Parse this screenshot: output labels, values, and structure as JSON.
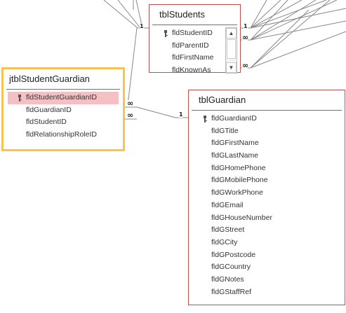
{
  "tables": {
    "students": {
      "title": "tblStudents",
      "fields": [
        "fldStudentID",
        "fldParentID",
        "fldFirstName",
        "fldKnownAs"
      ],
      "key_field_index": 0,
      "has_scrollbar": true
    },
    "student_guardian": {
      "title": "jtblStudentGuardian",
      "fields": [
        "fldStudentGuardianID",
        "fldGuardianID",
        "fldStudentID",
        "fldRelationshipRoleID"
      ],
      "key_field_index": 0,
      "selected": true
    },
    "guardian": {
      "title": "tblGuardian",
      "fields": [
        "fldGuardianID",
        "fldGTitle",
        "fldGFirstName",
        "fldGLastName",
        "fldGHomePhone",
        "fldGMobilePhone",
        "fldGWorkPhone",
        "fldGEmail",
        "fldGHouseNumber",
        "fldGStreet",
        "fldGCity",
        "fldGPostcode",
        "fldGCountry",
        "fldGNotes",
        "fldGStaffRef"
      ],
      "key_field_index": 0
    }
  },
  "cardinality_labels": {
    "one": "1",
    "many": "∞"
  },
  "icons": {
    "primary_key": "key-icon",
    "scroll_up": "chevron-up-icon",
    "scroll_down": "chevron-down-icon"
  },
  "colors": {
    "table_border": "#c0504d",
    "selected_border": "#f5c453",
    "selected_row": "#f6c0c3",
    "relationship_line": "#888888"
  }
}
